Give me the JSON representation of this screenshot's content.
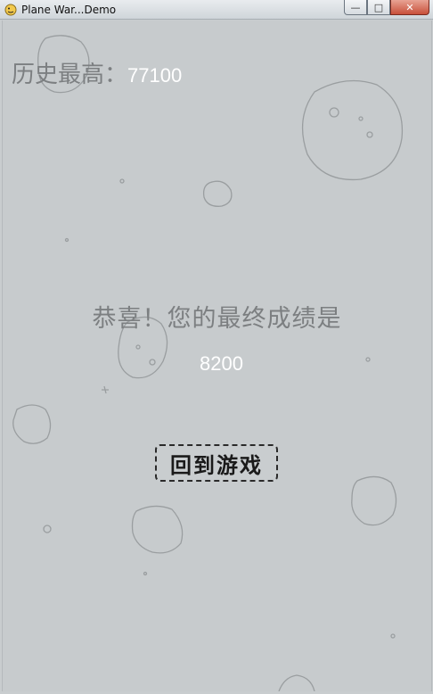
{
  "window": {
    "title": "Plane War...Demo",
    "buttons": {
      "minimize": "—",
      "maximize": "□",
      "close": "✕"
    }
  },
  "game": {
    "high_score_label": "历史最高：",
    "high_score_value": "77100",
    "congrats_text": "恭喜！您的最终成绩是",
    "final_score": "8200",
    "return_button_label": "回到游戏"
  },
  "colors": {
    "background": "#c7cbcd",
    "muted_text": "#7c7f81",
    "score_text": "#ffffff"
  }
}
